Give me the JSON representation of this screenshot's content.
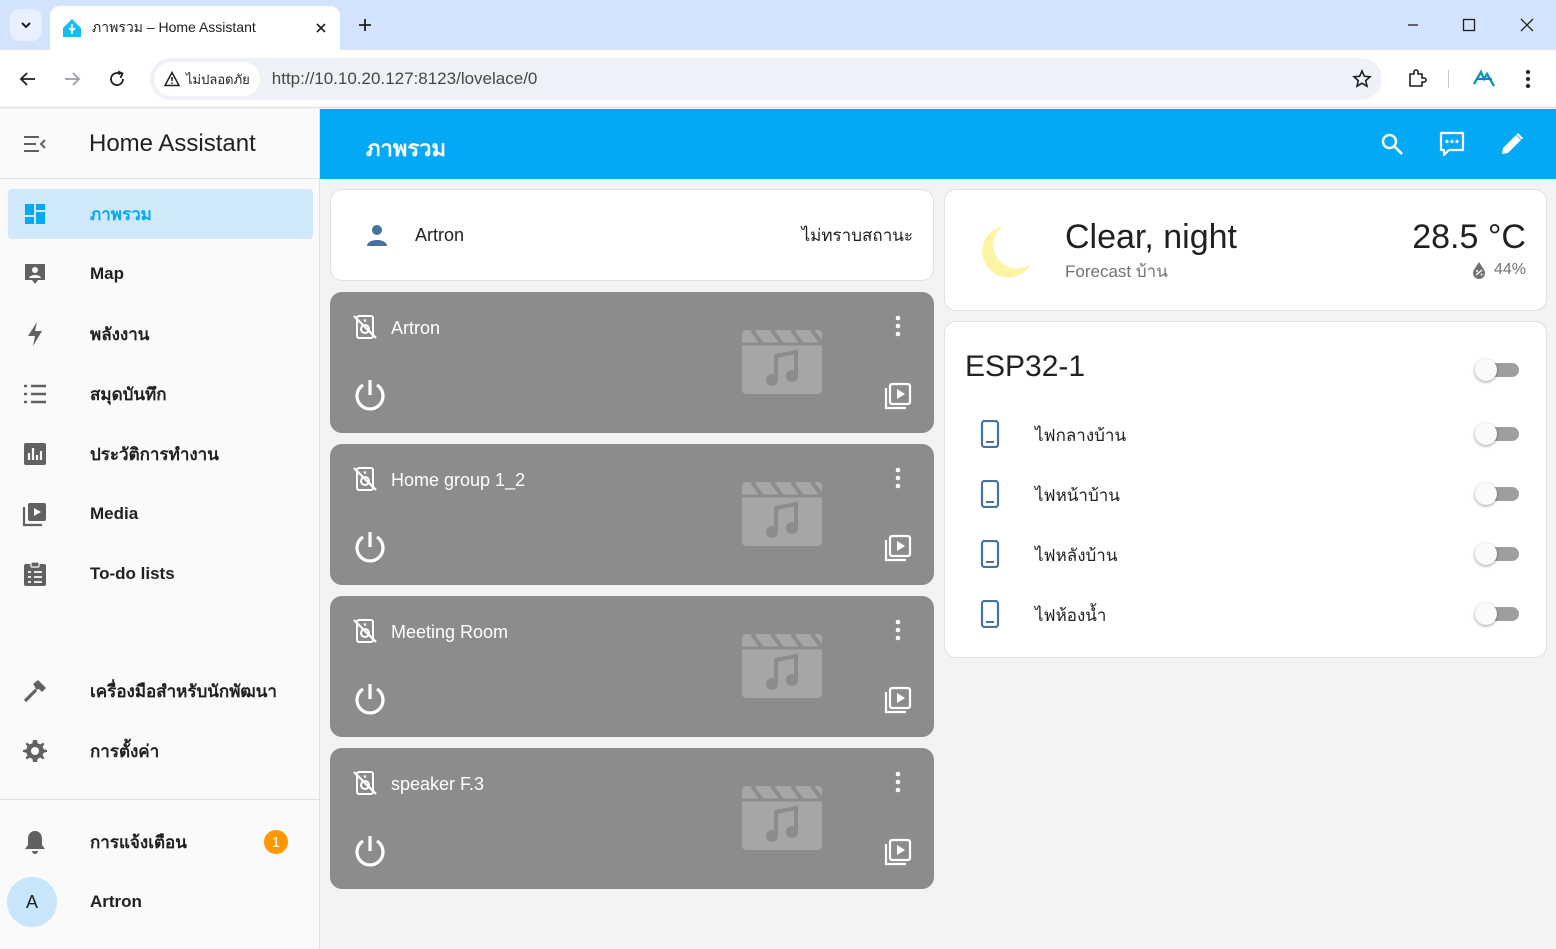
{
  "browser": {
    "tab_title": "ภาพรวม – Home Assistant",
    "insecure_label": "ไม่ปลอดภัย",
    "url": "http://10.10.20.127:8123/lovelace/0"
  },
  "sidebar": {
    "app_title": "Home Assistant",
    "items": [
      {
        "label": "ภาพรวม",
        "icon": "view-dashboard-icon",
        "active": true
      },
      {
        "label": "Map",
        "icon": "map-account-icon"
      },
      {
        "label": "พลังงาน",
        "icon": "lightning-bolt-icon"
      },
      {
        "label": "สมุดบันทึก",
        "icon": "format-list-icon"
      },
      {
        "label": "ประวัติการทำงาน",
        "icon": "chart-box-icon"
      },
      {
        "label": "Media",
        "icon": "play-box-multiple-icon"
      },
      {
        "label": "To-do lists",
        "icon": "clipboard-list-icon"
      }
    ],
    "developer_tools": "เครื่องมือสำหรับนักพัฒนา",
    "settings": "การตั้งค่า",
    "notifications": "การแจ้งเตือน",
    "notifications_count": "1",
    "user_initial": "A",
    "user_name": "Artron"
  },
  "header": {
    "title": "ภาพรวม"
  },
  "person_card": {
    "name": "Artron",
    "state": "ไม่ทราบสถานะ"
  },
  "media_players": [
    {
      "name": "Artron"
    },
    {
      "name": "Home group 1_2"
    },
    {
      "name": "Meeting Room"
    },
    {
      "name": "speaker F.3"
    }
  ],
  "weather": {
    "condition": "Clear, night",
    "subtitle": "Forecast บ้าน",
    "temperature": "28.5 °C",
    "humidity": "44%"
  },
  "entities": {
    "title": "ESP32-1",
    "rows": [
      {
        "name": "ไฟกลางบ้าน",
        "on": false
      },
      {
        "name": "ไฟหน้าบ้าน",
        "on": false
      },
      {
        "name": "ไฟหลังบ้าน",
        "on": false
      },
      {
        "name": "ไฟห้องน้ำ",
        "on": false
      }
    ]
  },
  "colors": {
    "primary": "#03a9f4",
    "sidebar_active_bg": "#cfe9fb",
    "media_card_bg": "#8c8c8c",
    "badge": "#ff9800",
    "entity_icon": "#44739e"
  }
}
